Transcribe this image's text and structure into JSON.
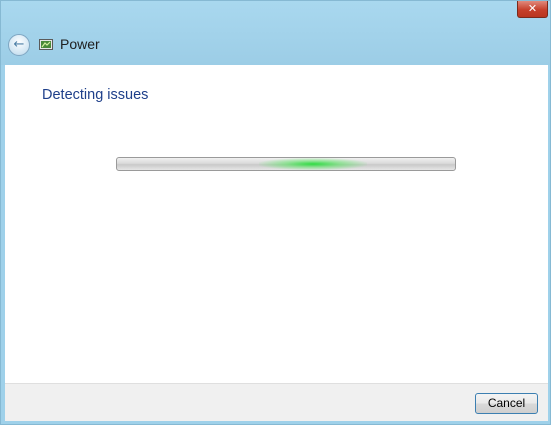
{
  "window": {
    "close_glyph": "✕",
    "back_glyph": "←",
    "app_icon": "power-troubleshooter-icon",
    "title": "Power"
  },
  "main": {
    "heading": "Detecting issues",
    "progress": {
      "state": "indeterminate",
      "glow_position_fraction": 0.58,
      "glow_width_fraction": 0.32
    }
  },
  "footer": {
    "cancel_label": "Cancel"
  },
  "colors": {
    "frame": "#9fd1ea",
    "heading": "#1e3f8a",
    "close_button": "#c6402b",
    "progress_glow": "#28dc3c",
    "button_focus_border": "#3c7fb1"
  }
}
